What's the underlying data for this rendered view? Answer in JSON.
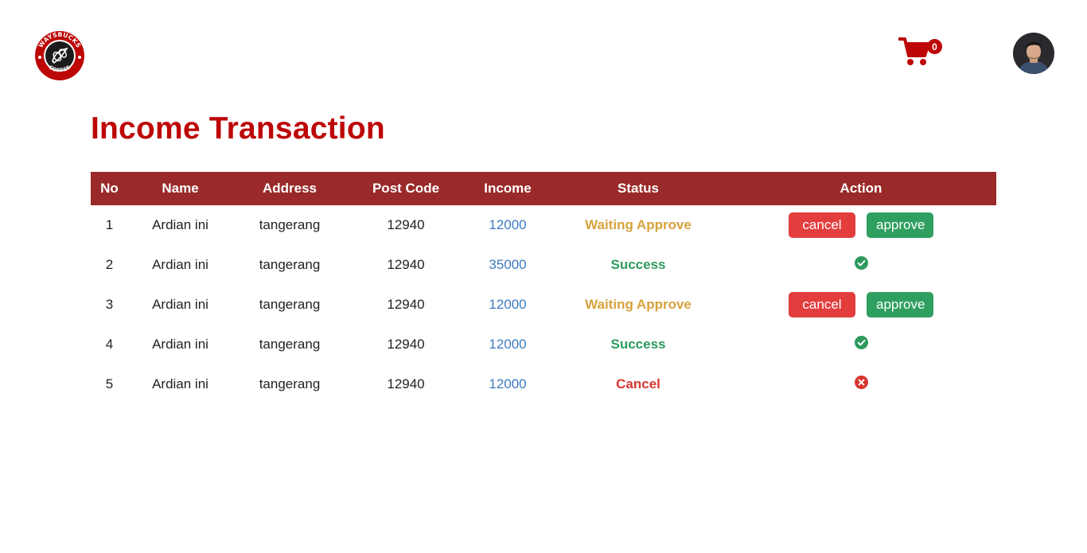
{
  "brand": {
    "logo_top_text": "WAYSBUCKS",
    "logo_bottom_text": "COFFEE",
    "logo_red": "#bd0707"
  },
  "nav": {
    "cart_icon": "cart-icon",
    "cart_count": "0",
    "avatar_icon": "user-avatar"
  },
  "page": {
    "title": "Income Transaction"
  },
  "colors": {
    "header_bg": "#9a2a2a",
    "title": "#bd0707",
    "waiting": "#d6a23c",
    "success": "#2e9a5e",
    "cancel": "#d8362f",
    "income": "#3c7bbf"
  },
  "table": {
    "headers": {
      "no": "No",
      "name": "Name",
      "address": "Address",
      "postcode": "Post Code",
      "income": "Income",
      "status": "Status",
      "action": "Action"
    },
    "rows": [
      {
        "no": "1",
        "name": "Ardian ini",
        "address": "tangerang",
        "postcode": "12940",
        "income": "12000",
        "status": "Waiting Approve",
        "status_type": "waiting",
        "action": "buttons",
        "cancel_label": "cancel",
        "approve_label": "approve"
      },
      {
        "no": "2",
        "name": "Ardian ini",
        "address": "tangerang",
        "postcode": "12940",
        "income": "35000",
        "status": "Success",
        "status_type": "success",
        "action": "check-circle-icon"
      },
      {
        "no": "3",
        "name": "Ardian ini",
        "address": "tangerang",
        "postcode": "12940",
        "income": "12000",
        "status": "Waiting Approve",
        "status_type": "waiting",
        "action": "buttons",
        "cancel_label": "cancel",
        "approve_label": "approve"
      },
      {
        "no": "4",
        "name": "Ardian ini",
        "address": "tangerang",
        "postcode": "12940",
        "income": "12000",
        "status": "Success",
        "status_type": "success",
        "action": "check-circle-icon"
      },
      {
        "no": "5",
        "name": "Ardian ini",
        "address": "tangerang",
        "postcode": "12940",
        "income": "12000",
        "status": "Cancel",
        "status_type": "cancel",
        "action": "x-circle-icon"
      }
    ]
  }
}
